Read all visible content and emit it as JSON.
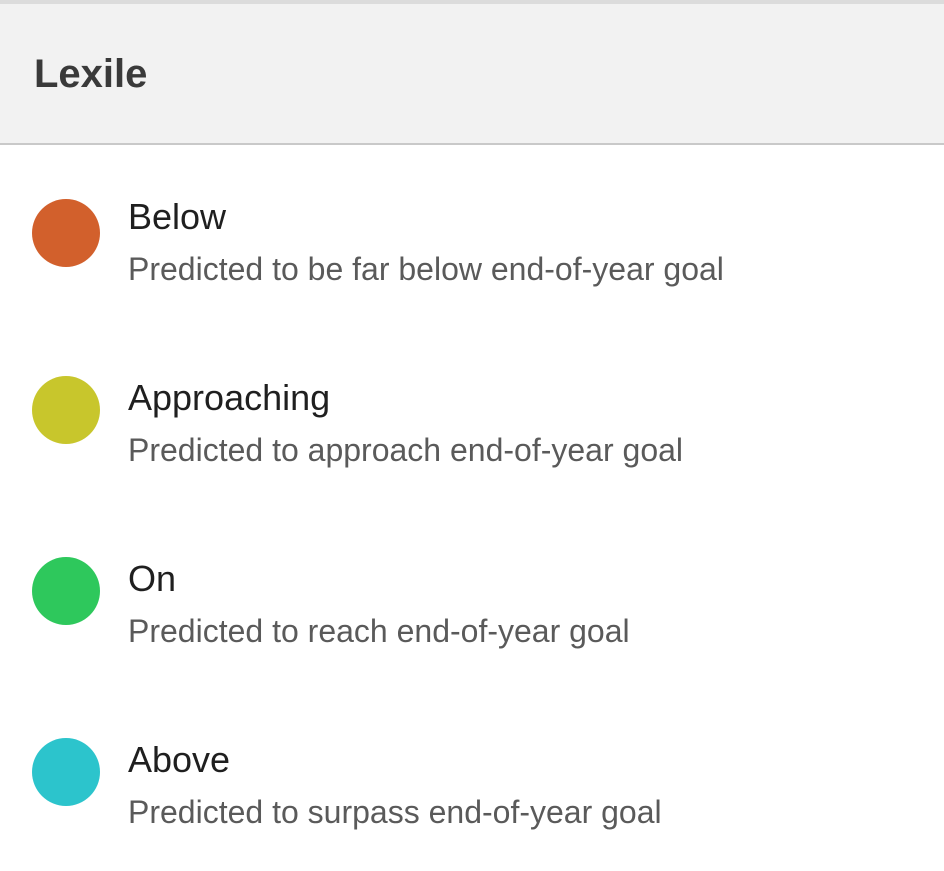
{
  "header": {
    "title": "Lexile"
  },
  "legend": {
    "items": [
      {
        "label": "Below",
        "description": "Predicted to be far below end-of-year goal",
        "color": "#d2602c"
      },
      {
        "label": "Approaching",
        "description": "Predicted to approach end-of-year goal",
        "color": "#c8c62c"
      },
      {
        "label": "On",
        "description": "Predicted to reach end-of-year goal",
        "color": "#2ec85c"
      },
      {
        "label": "Above",
        "description": "Predicted to surpass end-of-year goal",
        "color": "#2cc4cc"
      }
    ]
  }
}
